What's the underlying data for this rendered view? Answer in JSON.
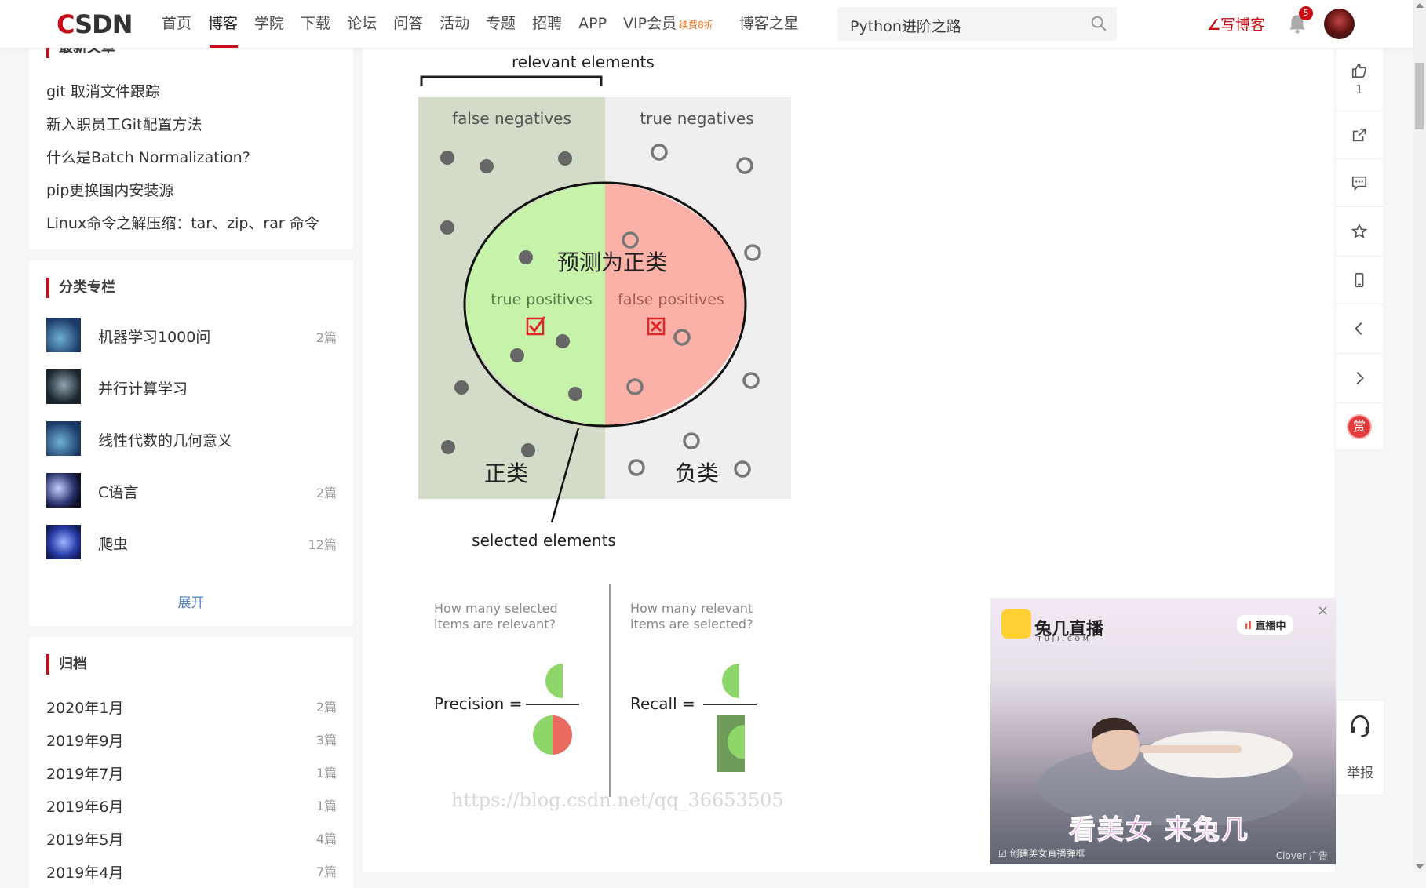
{
  "nav": {
    "logo_c": "C",
    "logo_rest": "SDN",
    "items": [
      "首页",
      "博客",
      "学院",
      "下载",
      "论坛",
      "问答",
      "活动",
      "专题",
      "招聘",
      "APP",
      "VIP会员",
      "博客之星"
    ],
    "vip_tag": "续费8折",
    "active_index": 1,
    "search_value": "Python进阶之路",
    "write_label": "写博客",
    "notification_count": "5"
  },
  "sidebar": {
    "recent": {
      "title": "最新文章",
      "items": [
        "git 取消文件跟踪",
        "新入职员工Git配置方法",
        "什么是Batch Normalization?",
        "pip更换国内安装源",
        "Linux命令之解压缩：tar、zip、rar 命令"
      ]
    },
    "categories": {
      "title": "分类专栏",
      "items": [
        {
          "name": "机器学习1000问",
          "count": "2篇"
        },
        {
          "name": "并行计算学习",
          "count": ""
        },
        {
          "name": "线性代数的几何意义",
          "count": ""
        },
        {
          "name": "C语言",
          "count": "2篇"
        },
        {
          "name": "爬虫",
          "count": "12篇"
        }
      ],
      "expand_label": "展开"
    },
    "archive": {
      "title": "归档",
      "items": [
        {
          "date": "2020年1月",
          "count": "2篇"
        },
        {
          "date": "2019年9月",
          "count": "3篇"
        },
        {
          "date": "2019年7月",
          "count": "1篇"
        },
        {
          "date": "2019年6月",
          "count": "1篇"
        },
        {
          "date": "2019年5月",
          "count": "4篇"
        },
        {
          "date": "2019年4月",
          "count": "7篇"
        }
      ]
    }
  },
  "figure": {
    "relevant_label": "relevant elements",
    "fn_label": "false negatives",
    "tn_label": "true negatives",
    "pred_pos_label": "预测为正类",
    "tp_label": "true positives",
    "fp_label": "false positives",
    "pos_label": "正类",
    "neg_label": "负类",
    "selected_label": "selected elements",
    "precision_q": [
      "How many selected",
      "items are relevant?"
    ],
    "recall_q": [
      "How many relevant",
      "items are selected?"
    ],
    "precision_label": "Precision =",
    "recall_label": "Recall =",
    "watermark": "https://blog.csdn.net/qq_36653505"
  },
  "right_toolbar": {
    "like_count": "1",
    "reward_label": "赏",
    "report_label": "举报"
  },
  "ad": {
    "brand": "兔几直播",
    "brand_sub": "TUJI.COM",
    "live_label": "直播中",
    "slogan": "看美女 来兔几",
    "checkbox_label": "创建美女直播弹框",
    "mark": "Clover 广告",
    "close": "×"
  },
  "colors": {
    "brand_red": "#ca0c16",
    "fn_bg": "#d3dcc9",
    "tn_bg": "#efefef",
    "tp_fill": "#c6f3a9",
    "fp_fill": "#fbb0a8"
  }
}
